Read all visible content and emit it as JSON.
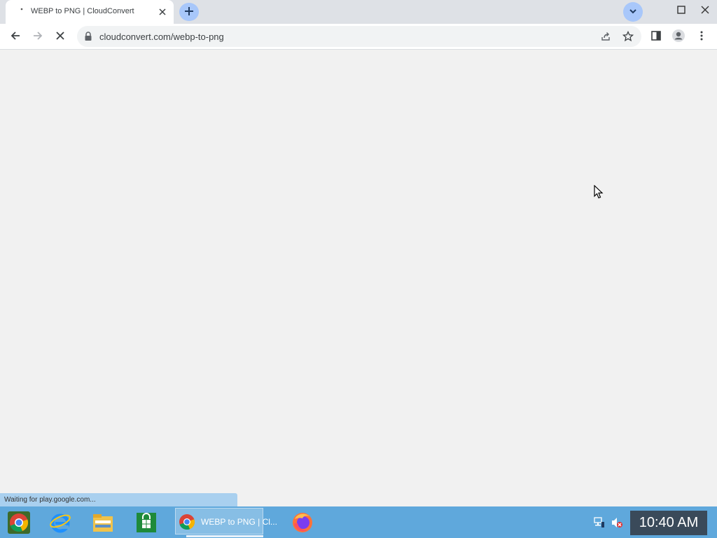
{
  "tab": {
    "title": "WEBP to PNG | CloudConvert"
  },
  "omnibox": {
    "url": "cloudconvert.com/webp-to-png"
  },
  "status": {
    "text": "Waiting for play.google.com..."
  },
  "taskbar": {
    "task_label": "WEBP to PNG | Cl...",
    "clock": "10:40 AM"
  },
  "colors": {
    "tabstrip_bg": "#dee1e6",
    "accent_button": "#a8c7fa",
    "content_bg": "#f1f1f1",
    "status_bubble": "#a9d0ef",
    "taskbar_bg": "#5fa8dc",
    "clock_bg": "#3a4a5a"
  },
  "icons": {
    "tab_favicon": "loading-dot-icon",
    "tab_close": "close-icon",
    "new_tab": "plus-icon",
    "tab_search": "chevron-down-icon",
    "back": "back-arrow-icon",
    "forward": "forward-arrow-icon",
    "stop": "stop-x-icon",
    "lock": "lock-icon",
    "share": "share-icon",
    "bookmark": "star-icon",
    "side_panel": "side-panel-icon",
    "profile": "profile-icon",
    "menu": "kebab-menu-icon",
    "taskbar_apps": [
      "chrome-app-icon",
      "internet-explorer-icon",
      "file-explorer-icon",
      "store-icon",
      "firefox-icon"
    ],
    "tray": [
      "network-icon",
      "volume-muted-icon"
    ]
  }
}
